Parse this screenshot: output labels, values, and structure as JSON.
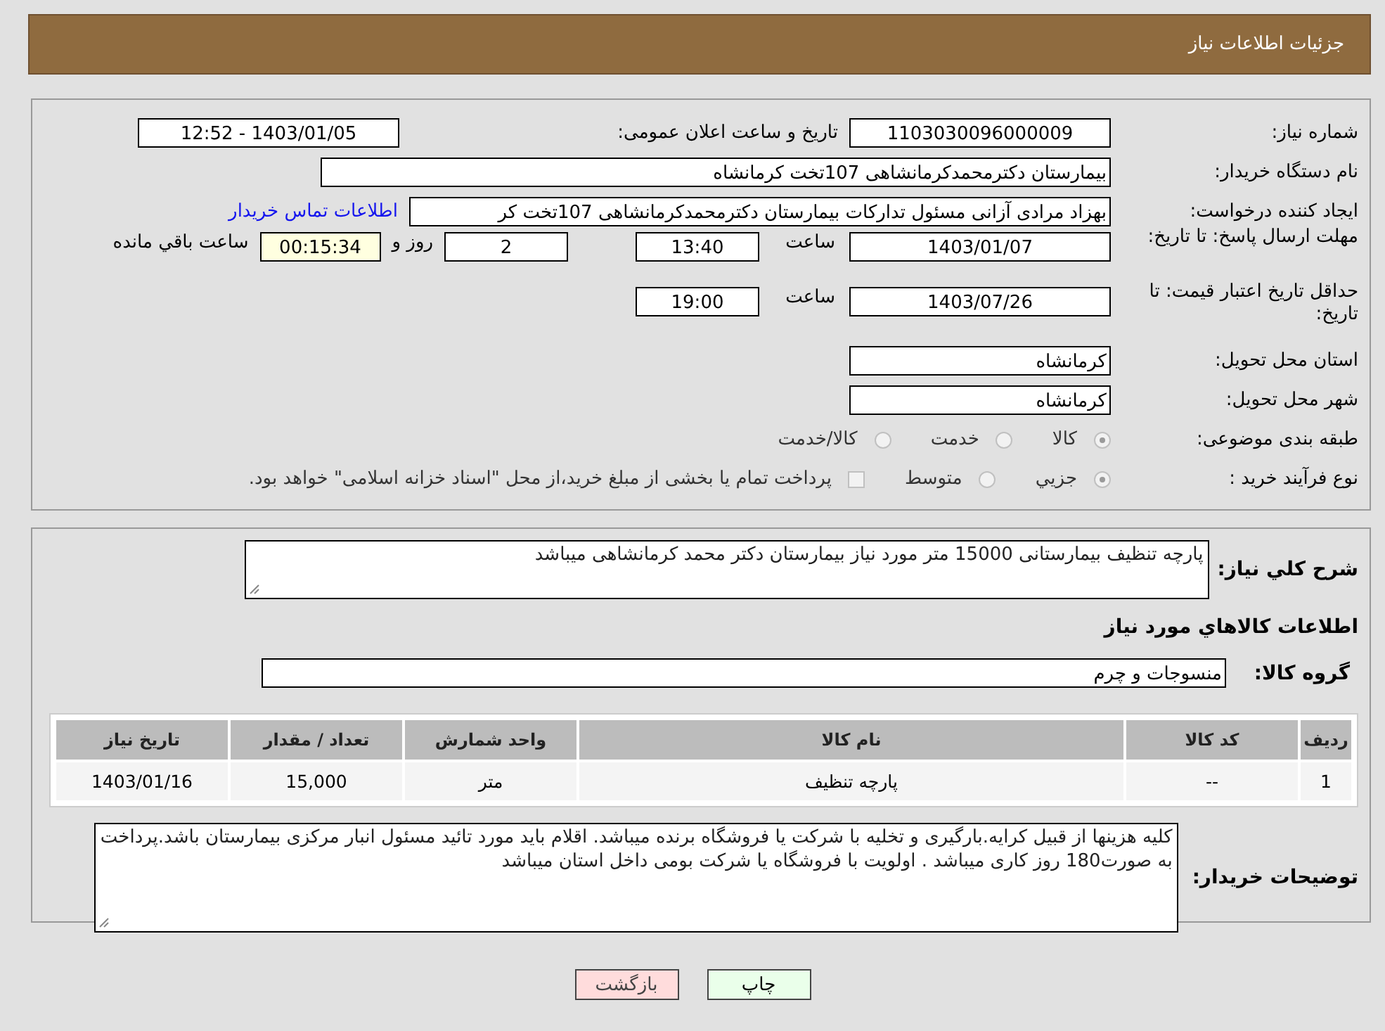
{
  "header": {
    "title": "جزئیات اطلاعات نیاز"
  },
  "need_number": {
    "label": "شماره نیاز:",
    "value": "1103030096000009"
  },
  "announce": {
    "label": "تاریخ و ساعت اعلان عمومی:",
    "value": "1403/01/05 - 12:52"
  },
  "buyer_org": {
    "label": "نام دستگاه خریدار:",
    "value": "بیمارستان دکترمحمدکرمانشاهی 107تخت کرمانشاه"
  },
  "requester": {
    "label": "ایجاد کننده درخواست:",
    "value": "بهزاد مرادی آزانی مسئول تدارکات بیمارستان دکترمحمدکرمانشاهی 107تخت کر",
    "link": "اطلاعات تماس خریدار"
  },
  "deadline": {
    "label": "مهلت ارسال پاسخ: تا تاریخ:",
    "date": "1403/01/07",
    "time_label": "ساعت",
    "time": "13:40",
    "days": "2",
    "days_label": "روز و",
    "remaining": "00:15:34",
    "remaining_label": "ساعت باقي مانده"
  },
  "validity": {
    "label": "حداقل تاریخ اعتبار قیمت: تا تاریخ:",
    "date": "1403/07/26",
    "time_label": "ساعت",
    "time": "19:00"
  },
  "province": {
    "label": "استان محل تحویل:",
    "value": "کرمانشاه"
  },
  "city": {
    "label": "شهر محل تحویل:",
    "value": "کرمانشاه"
  },
  "classification": {
    "label": "طبقه بندی موضوعی:",
    "options": [
      {
        "label": "کالا",
        "selected": true
      },
      {
        "label": "خدمت",
        "selected": false
      },
      {
        "label": "کالا/خدمت",
        "selected": false
      }
    ]
  },
  "purchase_type": {
    "label": "نوع فرآیند خرید :",
    "options": [
      {
        "label": "جزيي",
        "selected": true
      },
      {
        "label": "متوسط",
        "selected": false
      }
    ],
    "treasury": {
      "checked": false,
      "label": "پرداخت تمام یا بخشی از مبلغ خرید،از محل \"اسناد خزانه اسلامی\" خواهد بود."
    }
  },
  "summary": {
    "label": "شرح کلي نیاز:",
    "value": "پارچه تنظیف بیمارستانی 15000 متر مورد نیاز بیمارستان دکتر محمد کرمانشاهی میباشد"
  },
  "goods_heading": "اطلاعات کالاهاي مورد نياز",
  "goods_group": {
    "label": "گروه کالا:",
    "value": "منسوجات و چرم"
  },
  "table": {
    "columns": [
      "ردیف",
      "کد کالا",
      "نام کالا",
      "واحد شمارش",
      "تعداد / مقدار",
      "تاریخ نیاز"
    ],
    "rows": [
      [
        "1",
        "--",
        "پارچه تنظیف",
        "متر",
        "15,000",
        "1403/01/16"
      ]
    ]
  },
  "buyer_notes": {
    "label": "توضیحات خریدار:",
    "value": "کلیه هزینها از قبیل کرایه.بارگیری و تخلیه با شرکت یا فروشگاه برنده میباشد. اقلام باید مورد تائید مسئول انبار مرکزی بیمارستان باشد.پرداخت به صورت180 روز کاری میباشد . اولویت با فروشگاه یا شرکت بومی داخل استان میباشد"
  },
  "buttons": [
    {
      "label": "چاپ",
      "kind": "print"
    },
    {
      "label": "بازگشت",
      "kind": "back"
    }
  ]
}
